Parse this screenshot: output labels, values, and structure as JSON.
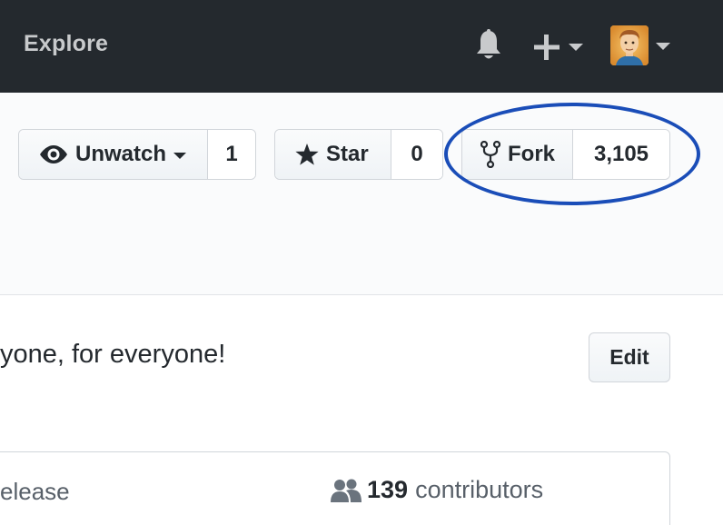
{
  "header": {
    "explore_label": "Explore",
    "icons": [
      "bell-icon",
      "plus-icon",
      "avatar"
    ]
  },
  "repo_actions": {
    "watch": {
      "label": "Unwatch",
      "count": "1"
    },
    "star": {
      "label": "Star",
      "count": "0"
    },
    "fork": {
      "label": "Fork",
      "count": "3,105"
    }
  },
  "about": {
    "description": "yone, for everyone!",
    "edit_label": "Edit"
  },
  "summary": {
    "release_text": "elease",
    "contributors_count": "139",
    "contributors_label": "contributors"
  },
  "colors": {
    "nav_bg": "#24292e",
    "nav_text": "#c8cacc",
    "highlight": "#1a4db8"
  }
}
